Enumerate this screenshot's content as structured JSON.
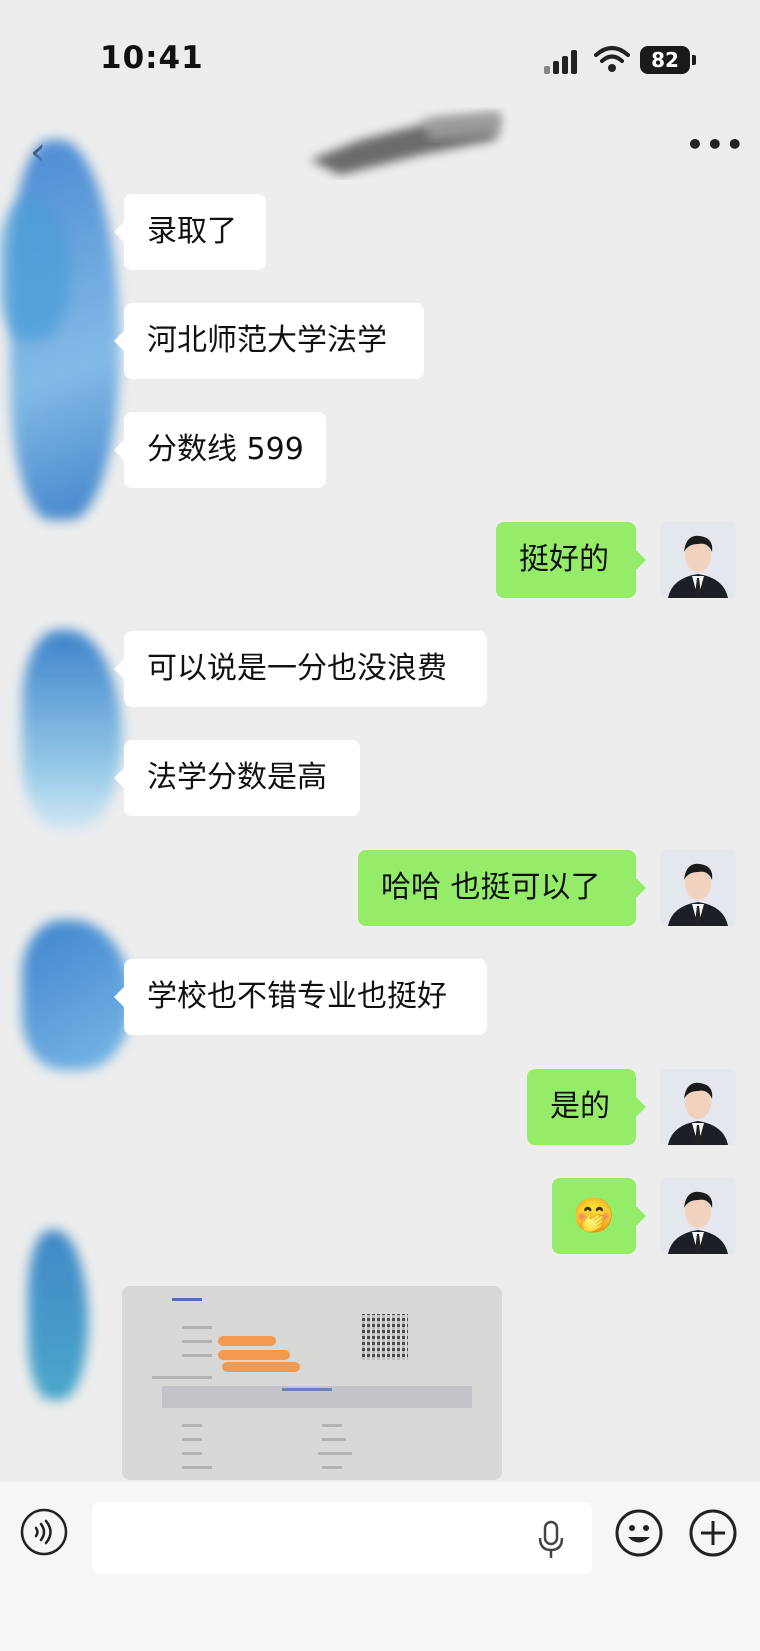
{
  "status_bar": {
    "time": "10:41",
    "battery": "82"
  },
  "header": {
    "more_label": "•••"
  },
  "messages": [
    {
      "side": "in",
      "text": "录取了"
    },
    {
      "side": "in",
      "text": "河北师范大学法学"
    },
    {
      "side": "in",
      "text": "分数线 599"
    },
    {
      "side": "out",
      "text": "挺好的"
    },
    {
      "side": "in",
      "text": "可以说是一分也没浪费"
    },
    {
      "side": "in",
      "text": "法学分数是高"
    },
    {
      "side": "out",
      "text": "哈哈 也挺可以了"
    },
    {
      "side": "in",
      "text": "学校也不错专业也挺好"
    },
    {
      "side": "out",
      "text": "是的"
    },
    {
      "side": "out",
      "emoji": "🤭"
    }
  ],
  "image_message": {
    "type": "photo-of-admission-document"
  },
  "input_bar": {
    "value": "",
    "icons": [
      "voice-icon",
      "microphone-icon",
      "emoji-icon",
      "plus-icon"
    ]
  },
  "colors": {
    "background": "#ededed",
    "bubble_in": "#ffffff",
    "bubble_out": "#95ec69",
    "input_bar": "#f6f6f6"
  }
}
